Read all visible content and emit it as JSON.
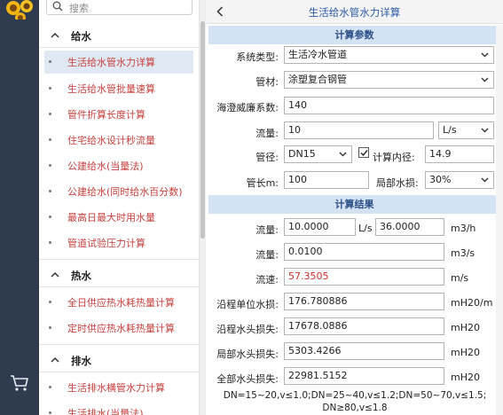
{
  "search": {
    "placeholder": "搜索"
  },
  "menu": {
    "sections": [
      {
        "title": "给水",
        "items": [
          "生活给水管水力详算",
          "生活给水管批量速算",
          "管件折算长度计算",
          "住宅给水设计秒流量",
          "公建给水(当量法)",
          "公建给水(同时给水百分数)",
          "最高日最大时用水量",
          "管道试验压力计算"
        ]
      },
      {
        "title": "热水",
        "items": [
          "全日供应热水耗热量计算",
          "定时供应热水耗热量计算"
        ]
      },
      {
        "title": "排水",
        "items": [
          "生活排水横管水力计算",
          "生活排水(当量法)"
        ]
      }
    ]
  },
  "panel": {
    "title": "生活给水管水力详算",
    "params_header": "计算参数",
    "results_header": "计算结果",
    "params": {
      "system_label": "系统类型:",
      "system_value": "生活冷水管道",
      "material_label": "管材:",
      "material_value": "涂塑复合钢管",
      "hazen_label": "海澄威廉系数:",
      "hazen_value": "140",
      "flow_label": "流量:",
      "flow_value": "10",
      "flow_unit": "L/s",
      "dia_label": "管径:",
      "dia_value": "DN15",
      "inner_label": "计算内径:",
      "inner_value": "14.9",
      "length_label": "管长m:",
      "length_value": "100",
      "local_label": "局部水损:",
      "local_value": "30%"
    },
    "results": {
      "flow_label": "流量:",
      "flow_ls": "10.0000",
      "flow_ls_unit": "L/s",
      "flow_m3h": "36.0000",
      "flow_m3h_unit": "m3/h",
      "flow2_label": "流量:",
      "flow_m3s": "0.0100",
      "flow_m3s_unit": "m3/s",
      "velocity_label": "流速:",
      "velocity": "57.3505",
      "velocity_unit": "m/s",
      "unit_loss_label": "沿程单位水损:",
      "unit_loss": "176.780886",
      "unit_loss_unit": "mH20/m",
      "head_loss_label": "沿程水头损失:",
      "head_loss": "17678.0886",
      "head_loss_unit": "mH20",
      "local_head_label": "局部水头损失:",
      "local_head": "5303.4266",
      "local_head_unit": "mH20",
      "total_head_label": "全部水头损失:",
      "total_head": "22981.5152",
      "total_head_unit": "mH20"
    },
    "note_line1": "DN=15~20,v≤1.0;DN=25~40,v≤1.2;DN=50~70,v≤1.5;",
    "note_line2": "DN≥80,v≤1.8"
  },
  "colors": {
    "rail": "#2f3b4f",
    "menu_text": "#c8413d",
    "active_item": "#dfe8f3",
    "header_bar": "#d4e3f4",
    "title": "#2a5aa8",
    "warning_value": "#d0302a"
  },
  "icons": [
    "sunflower-logo-icon",
    "search-icon",
    "cart-icon",
    "chevron-up-icon",
    "chevron-down-icon",
    "back-icon",
    "checkbox-checked-icon"
  ]
}
